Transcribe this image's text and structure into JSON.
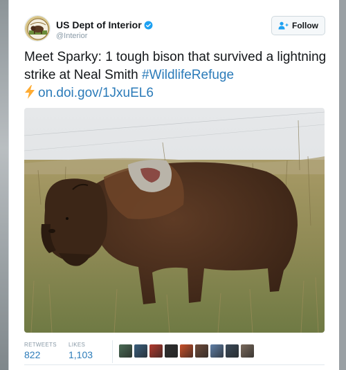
{
  "account": {
    "name": "US Dept of Interior",
    "handle": "@Interior",
    "avatar_icon": "bison-seal-icon",
    "verified_icon": "verified-badge-icon"
  },
  "follow_button": {
    "label": "Follow",
    "icon": "add-user-icon"
  },
  "tweet": {
    "text_before": "Meet Sparky: 1 tough bison that survived a lightning strike at Neal Smith ",
    "hashtag": "#WildlifeRefuge",
    "emoji": "lightning-bolt-icon",
    "link": "on.doi.gov/1JxuEL6"
  },
  "stats": {
    "retweets_label": "RETWEETS",
    "retweets_value": "822",
    "likes_label": "LIKES",
    "likes_value": "1,103"
  },
  "likers": [
    {
      "color": "#4a6b55"
    },
    {
      "color": "#3a5f7d"
    },
    {
      "color": "#b23a2e"
    },
    {
      "color": "#2f2f2f"
    },
    {
      "color": "#c8502a"
    },
    {
      "color": "#6e4b3a"
    },
    {
      "color": "#5f7fa6"
    },
    {
      "color": "#3b4a59"
    },
    {
      "color": "#7a6a5c"
    }
  ],
  "colors": {
    "link": "#2b7bb9",
    "verified": "#1da1f2",
    "bolt": "#ffac33"
  }
}
